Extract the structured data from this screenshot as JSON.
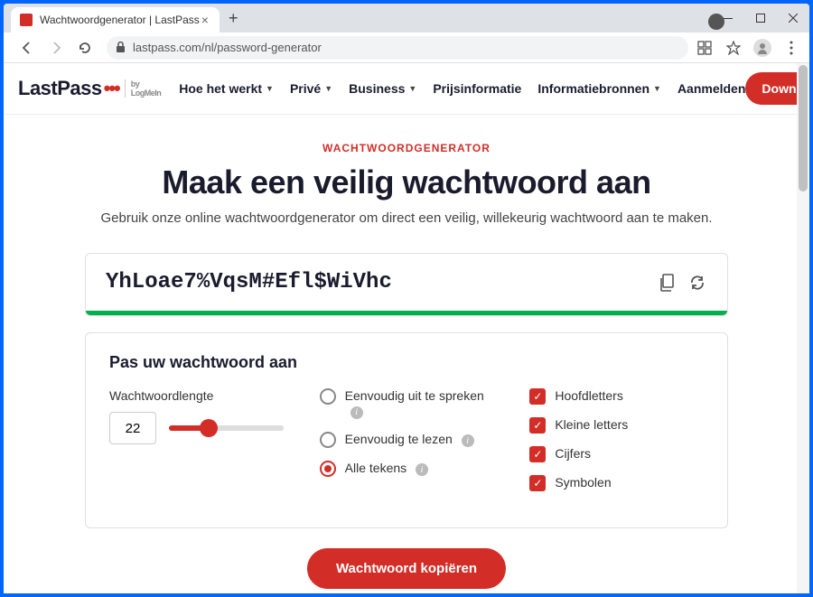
{
  "browser": {
    "tab_title": "Wachtwoordgenerator | LastPass",
    "url": "lastpass.com/nl/password-generator"
  },
  "nav": {
    "logo_main": "Last",
    "logo_second": "Pass",
    "logo_dots": "•••",
    "logo_sub": "by LogMeIn",
    "items": [
      {
        "label": "Hoe het werkt",
        "dropdown": true
      },
      {
        "label": "Privé",
        "dropdown": true
      },
      {
        "label": "Business",
        "dropdown": true
      },
      {
        "label": "Prijsinformatie",
        "dropdown": false
      },
      {
        "label": "Informatiebronnen",
        "dropdown": true
      },
      {
        "label": "Aanmelden",
        "dropdown": false
      }
    ],
    "cta": "Download LastPass Free"
  },
  "hero": {
    "eyebrow": "WACHTWOORDGENERATOR",
    "title": "Maak een veilig wachtwoord aan",
    "subtitle": "Gebruik onze online wachtwoordgenerator om direct een veilig, willekeurig wachtwoord aan te maken."
  },
  "password": {
    "value": "YhLoae7%VqsM#Efl$WiVhc"
  },
  "customize": {
    "title": "Pas uw wachtwoord aan",
    "length_label": "Wachtwoordlengte",
    "length_value": "22",
    "radios": [
      {
        "label": "Eenvoudig uit te spreken",
        "selected": false,
        "info": true
      },
      {
        "label": "Eenvoudig te lezen",
        "selected": false,
        "info": true
      },
      {
        "label": "Alle tekens",
        "selected": true,
        "info": true
      }
    ],
    "checks": [
      {
        "label": "Hoofdletters",
        "checked": true
      },
      {
        "label": "Kleine letters",
        "checked": true
      },
      {
        "label": "Cijfers",
        "checked": true
      },
      {
        "label": "Symbolen",
        "checked": true
      }
    ]
  },
  "copy_button": "Wachtwoord kopiëren"
}
